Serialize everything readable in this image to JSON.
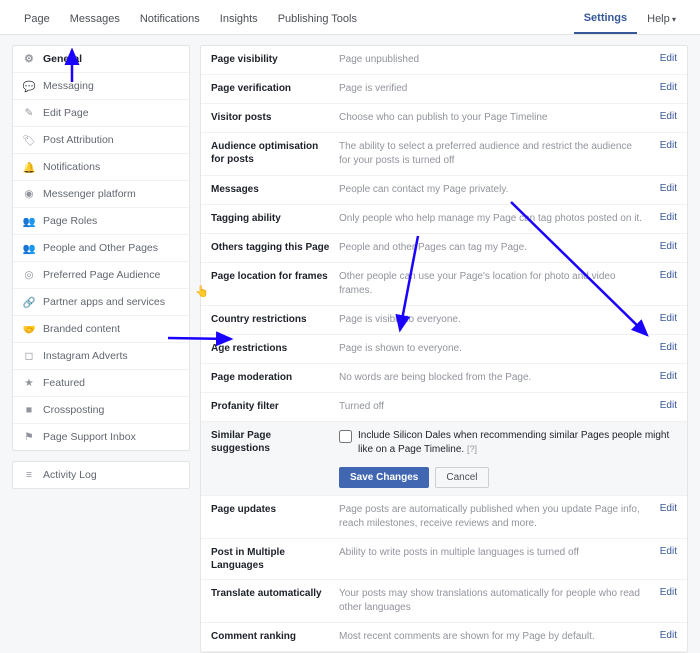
{
  "nav": {
    "page": "Page",
    "messages": "Messages",
    "notifications": "Notifications",
    "insights": "Insights",
    "publishing": "Publishing Tools",
    "settings": "Settings",
    "help": "Help"
  },
  "sidebar": {
    "items": [
      {
        "label": "General",
        "icon": "gear-icon"
      },
      {
        "label": "Messaging",
        "icon": "chat-icon"
      },
      {
        "label": "Edit Page",
        "icon": "pencil-icon"
      },
      {
        "label": "Post Attribution",
        "icon": "tag-icon"
      },
      {
        "label": "Notifications",
        "icon": "bell-icon"
      },
      {
        "label": "Messenger platform",
        "icon": "messenger-icon"
      },
      {
        "label": "Page Roles",
        "icon": "people-icon"
      },
      {
        "label": "People and Other Pages",
        "icon": "people-icon"
      },
      {
        "label": "Preferred Page Audience",
        "icon": "target-icon"
      },
      {
        "label": "Partner apps and services",
        "icon": "link-icon"
      },
      {
        "label": "Branded content",
        "icon": "handshake-icon"
      },
      {
        "label": "Instagram Adverts",
        "icon": "instagram-icon"
      },
      {
        "label": "Featured",
        "icon": "star-icon"
      },
      {
        "label": "Crossposting",
        "icon": "video-icon"
      },
      {
        "label": "Page Support Inbox",
        "icon": "flag-icon"
      }
    ],
    "activity": "Activity Log"
  },
  "rows": {
    "visibility": {
      "label": "Page visibility",
      "value": "Page unpublished",
      "edit": "Edit"
    },
    "verification": {
      "label": "Page verification",
      "value": "Page is verified",
      "edit": "Edit"
    },
    "visitor": {
      "label": "Visitor posts",
      "value": "Choose who can publish to your Page Timeline",
      "edit": "Edit"
    },
    "audience": {
      "label": "Audience optimisation for posts",
      "value": "The ability to select a preferred audience and restrict the audience for your posts is turned off",
      "edit": "Edit"
    },
    "messages": {
      "label": "Messages",
      "value": "People can contact my Page privately.",
      "edit": "Edit"
    },
    "tagging": {
      "label": "Tagging ability",
      "value": "Only people who help manage my Page can tag photos posted on it.",
      "edit": "Edit"
    },
    "others": {
      "label": "Others tagging this Page",
      "value": "People and other Pages can tag my Page.",
      "edit": "Edit"
    },
    "frames": {
      "label": "Page location for frames",
      "value": "Other people can use your Page's location for photo and video frames.",
      "edit": "Edit"
    },
    "country": {
      "label": "Country restrictions",
      "value": "Page is visible to everyone.",
      "edit": "Edit"
    },
    "age": {
      "label": "Age restrictions",
      "value": "Page is shown to everyone.",
      "edit": "Edit"
    },
    "moderation": {
      "label": "Page moderation",
      "value": "No words are being blocked from the Page.",
      "edit": "Edit"
    },
    "profanity": {
      "label": "Profanity filter",
      "value": "Turned off",
      "edit": "Edit"
    },
    "similar": {
      "label": "Similar Page suggestions",
      "checkbox_text": "Include Silicon Dales when recommending similar Pages people might like on a Page Timeline.",
      "help": "[?]",
      "save": "Save Changes",
      "cancel": "Cancel"
    },
    "updates": {
      "label": "Page updates",
      "value": "Page posts are automatically published when you update Page info, reach milestones, receive reviews and more.",
      "edit": "Edit"
    },
    "multilang": {
      "label": "Post in Multiple Languages",
      "value": "Ability to write posts in multiple languages is turned off",
      "edit": "Edit"
    },
    "translate": {
      "label": "Translate automatically",
      "value": "Your posts may show translations automatically for people who read other languages",
      "edit": "Edit"
    },
    "comment": {
      "label": "Comment ranking",
      "value": "Most recent comments are shown for my Page by default.",
      "edit": "Edit"
    }
  }
}
